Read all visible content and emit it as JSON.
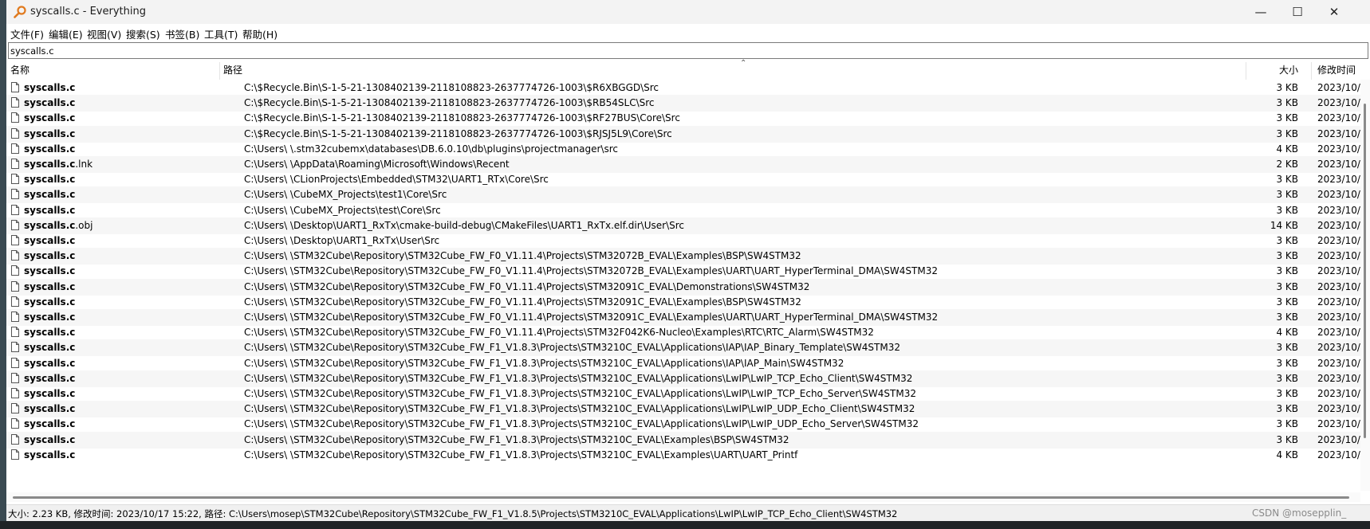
{
  "window": {
    "title": "syscalls.c - Everything"
  },
  "menu": [
    "文件(F)",
    "编辑(E)",
    "视图(V)",
    "搜索(S)",
    "书签(B)",
    "工具(T)",
    "帮助(H)"
  ],
  "search": {
    "value": "syscalls.c"
  },
  "columns": {
    "name": "名称",
    "path": "路径",
    "size": "大小",
    "date": "修改时间"
  },
  "rows": [
    {
      "name_bold": "syscalls.c",
      "name_ext": "",
      "path": "C:\\$Recycle.Bin\\S-1-5-21-1308402139-2118108823-2637774726-1003\\$R6XBGGD\\Src",
      "size": "3 KB",
      "date": "2023/10/"
    },
    {
      "name_bold": "syscalls.c",
      "name_ext": "",
      "path": "C:\\$Recycle.Bin\\S-1-5-21-1308402139-2118108823-2637774726-1003\\$RB54SLC\\Src",
      "size": "3 KB",
      "date": "2023/10/"
    },
    {
      "name_bold": "syscalls.c",
      "name_ext": "",
      "path": "C:\\$Recycle.Bin\\S-1-5-21-1308402139-2118108823-2637774726-1003\\$RF27BUS\\Core\\Src",
      "size": "3 KB",
      "date": "2023/10/"
    },
    {
      "name_bold": "syscalls.c",
      "name_ext": "",
      "path": "C:\\$Recycle.Bin\\S-1-5-21-1308402139-2118108823-2637774726-1003\\$RJSJ5L9\\Core\\Src",
      "size": "3 KB",
      "date": "2023/10/"
    },
    {
      "name_bold": "syscalls.c",
      "name_ext": "",
      "path": "C:\\Users\\        \\.stm32cubemx\\databases\\DB.6.0.10\\db\\plugins\\projectmanager\\src",
      "size": "4 KB",
      "date": "2023/10/"
    },
    {
      "name_bold": "syscalls.c",
      "name_ext": ".lnk",
      "path": "C:\\Users\\        \\AppData\\Roaming\\Microsoft\\Windows\\Recent",
      "size": "2 KB",
      "date": "2023/10/"
    },
    {
      "name_bold": "syscalls.c",
      "name_ext": "",
      "path": "C:\\Users\\        \\CLionProjects\\Embedded\\STM32\\UART1_RTx\\Core\\Src",
      "size": "3 KB",
      "date": "2023/10/"
    },
    {
      "name_bold": "syscalls.c",
      "name_ext": "",
      "path": "C:\\Users\\        \\CubeMX_Projects\\test1\\Core\\Src",
      "size": "3 KB",
      "date": "2023/10/"
    },
    {
      "name_bold": "syscalls.c",
      "name_ext": "",
      "path": "C:\\Users\\        \\CubeMX_Projects\\test\\Core\\Src",
      "size": "3 KB",
      "date": "2023/10/"
    },
    {
      "name_bold": "syscalls.c",
      "name_ext": ".obj",
      "path": "C:\\Users\\        \\Desktop\\UART1_RxTx\\cmake-build-debug\\CMakeFiles\\UART1_RxTx.elf.dir\\User\\Src",
      "size": "14 KB",
      "date": "2023/10/"
    },
    {
      "name_bold": "syscalls.c",
      "name_ext": "",
      "path": "C:\\Users\\        \\Desktop\\UART1_RxTx\\User\\Src",
      "size": "3 KB",
      "date": "2023/10/"
    },
    {
      "name_bold": "syscalls.c",
      "name_ext": "",
      "path": "C:\\Users\\        \\STM32Cube\\Repository\\STM32Cube_FW_F0_V1.11.4\\Projects\\STM32072B_EVAL\\Examples\\BSP\\SW4STM32",
      "size": "3 KB",
      "date": "2023/10/"
    },
    {
      "name_bold": "syscalls.c",
      "name_ext": "",
      "path": "C:\\Users\\        \\STM32Cube\\Repository\\STM32Cube_FW_F0_V1.11.4\\Projects\\STM32072B_EVAL\\Examples\\UART\\UART_HyperTerminal_DMA\\SW4STM32",
      "size": "3 KB",
      "date": "2023/10/"
    },
    {
      "name_bold": "syscalls.c",
      "name_ext": "",
      "path": "C:\\Users\\        \\STM32Cube\\Repository\\STM32Cube_FW_F0_V1.11.4\\Projects\\STM32091C_EVAL\\Demonstrations\\SW4STM32",
      "size": "3 KB",
      "date": "2023/10/"
    },
    {
      "name_bold": "syscalls.c",
      "name_ext": "",
      "path": "C:\\Users\\        \\STM32Cube\\Repository\\STM32Cube_FW_F0_V1.11.4\\Projects\\STM32091C_EVAL\\Examples\\BSP\\SW4STM32",
      "size": "3 KB",
      "date": "2023/10/"
    },
    {
      "name_bold": "syscalls.c",
      "name_ext": "",
      "path": "C:\\Users\\        \\STM32Cube\\Repository\\STM32Cube_FW_F0_V1.11.4\\Projects\\STM32091C_EVAL\\Examples\\UART\\UART_HyperTerminal_DMA\\SW4STM32",
      "size": "3 KB",
      "date": "2023/10/"
    },
    {
      "name_bold": "syscalls.c",
      "name_ext": "",
      "path": "C:\\Users\\        \\STM32Cube\\Repository\\STM32Cube_FW_F0_V1.11.4\\Projects\\STM32F042K6-Nucleo\\Examples\\RTC\\RTC_Alarm\\SW4STM32",
      "size": "4 KB",
      "date": "2023/10/"
    },
    {
      "name_bold": "syscalls.c",
      "name_ext": "",
      "path": "C:\\Users\\        \\STM32Cube\\Repository\\STM32Cube_FW_F1_V1.8.3\\Projects\\STM3210C_EVAL\\Applications\\IAP\\IAP_Binary_Template\\SW4STM32",
      "size": "3 KB",
      "date": "2023/10/"
    },
    {
      "name_bold": "syscalls.c",
      "name_ext": "",
      "path": "C:\\Users\\        \\STM32Cube\\Repository\\STM32Cube_FW_F1_V1.8.3\\Projects\\STM3210C_EVAL\\Applications\\IAP\\IAP_Main\\SW4STM32",
      "size": "3 KB",
      "date": "2023/10/"
    },
    {
      "name_bold": "syscalls.c",
      "name_ext": "",
      "path": "C:\\Users\\        \\STM32Cube\\Repository\\STM32Cube_FW_F1_V1.8.3\\Projects\\STM3210C_EVAL\\Applications\\LwIP\\LwIP_TCP_Echo_Client\\SW4STM32",
      "size": "3 KB",
      "date": "2023/10/"
    },
    {
      "name_bold": "syscalls.c",
      "name_ext": "",
      "path": "C:\\Users\\        \\STM32Cube\\Repository\\STM32Cube_FW_F1_V1.8.3\\Projects\\STM3210C_EVAL\\Applications\\LwIP\\LwIP_TCP_Echo_Server\\SW4STM32",
      "size": "3 KB",
      "date": "2023/10/"
    },
    {
      "name_bold": "syscalls.c",
      "name_ext": "",
      "path": "C:\\Users\\        \\STM32Cube\\Repository\\STM32Cube_FW_F1_V1.8.3\\Projects\\STM3210C_EVAL\\Applications\\LwIP\\LwIP_UDP_Echo_Client\\SW4STM32",
      "size": "3 KB",
      "date": "2023/10/"
    },
    {
      "name_bold": "syscalls.c",
      "name_ext": "",
      "path": "C:\\Users\\        \\STM32Cube\\Repository\\STM32Cube_FW_F1_V1.8.3\\Projects\\STM3210C_EVAL\\Applications\\LwIP\\LwIP_UDP_Echo_Server\\SW4STM32",
      "size": "3 KB",
      "date": "2023/10/"
    },
    {
      "name_bold": "syscalls.c",
      "name_ext": "",
      "path": "C:\\Users\\        \\STM32Cube\\Repository\\STM32Cube_FW_F1_V1.8.3\\Projects\\STM3210C_EVAL\\Examples\\BSP\\SW4STM32",
      "size": "3 KB",
      "date": "2023/10/"
    },
    {
      "name_bold": "syscalls.c",
      "name_ext": "",
      "path": "C:\\Users\\        \\STM32Cube\\Repository\\STM32Cube_FW_F1_V1.8.3\\Projects\\STM3210C_EVAL\\Examples\\UART\\UART_Printf",
      "size": "4 KB",
      "date": "2023/10/"
    }
  ],
  "status": {
    "text": "大小: 2.23 KB, 修改时间: 2023/10/17 15:22, 路径: C:\\Users\\mosep\\STM32Cube\\Repository\\STM32Cube_FW_F1_V1.8.5\\Projects\\STM3210C_EVAL\\Applications\\LwIP\\LwIP_TCP_Echo_Client\\SW4STM32",
    "watermark": "CSDN @mosepplin_"
  },
  "icons": {
    "app": "magnifier-icon",
    "file": "file-icon",
    "minimize": "minimize-icon",
    "maximize": "maximize-icon",
    "close": "close-icon",
    "sort": "sort-ascending-icon"
  },
  "colors": {
    "app_icon": "#e07a1f",
    "header_bg": "#ffffff",
    "status_bg": "#f0f0f0"
  }
}
